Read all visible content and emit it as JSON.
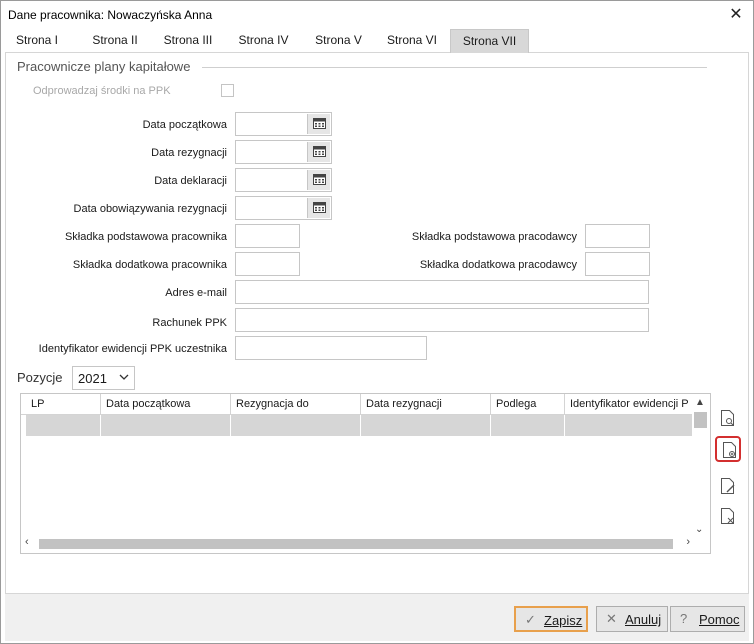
{
  "window": {
    "title": "Dane pracownika: Nowaczyńska Anna",
    "close_glyph": "✕"
  },
  "tabs": [
    {
      "label": "Strona I",
      "active": false
    },
    {
      "label": "Strona II",
      "active": false
    },
    {
      "label": "Strona III",
      "active": false
    },
    {
      "label": "Strona IV",
      "active": false
    },
    {
      "label": "Strona V",
      "active": false
    },
    {
      "label": "Strona VI",
      "active": false
    },
    {
      "label": "Strona VII",
      "active": true
    }
  ],
  "ppk": {
    "section_title": "Pracownicze plany kapitałowe",
    "send_funds_label": "Odprowadzaj środki na PPK",
    "send_funds_checked": false,
    "start_date_label": "Data początkowa",
    "resignation_date_label": "Data rezygnacji",
    "declaration_date_label": "Data deklaracji",
    "resignation_valid_label": "Data obowiązywania rezygnacji",
    "employee_basic_label": "Składka podstawowa pracownika",
    "employer_basic_label": "Składka podstawowa pracodawcy",
    "employee_extra_label": "Składka dodatkowa pracownika",
    "employer_extra_label": "Składka dodatkowa pracodawcy",
    "email_label": "Adres e-mail",
    "account_label": "Rachunek PPK",
    "participant_id_label": "Identyfikator ewidencji PPK uczestnika",
    "start_date_value": "",
    "resignation_date_value": "",
    "declaration_date_value": "",
    "resignation_valid_value": "",
    "employee_basic_value": "",
    "employer_basic_value": "",
    "employee_extra_value": "",
    "employer_extra_value": "",
    "email_value": "",
    "account_value": "",
    "participant_id_value": ""
  },
  "positions": {
    "label": "Pozycje",
    "year": "2021",
    "columns": [
      "LP",
      "Data początkowa",
      "Rezygnacja do",
      "Data rezygnacji",
      "Podlega",
      "Identyfikator ewidencji P"
    ]
  },
  "side_toolbar": [
    {
      "icon": "view-document-icon"
    },
    {
      "icon": "add-document-icon",
      "highlighted": true
    },
    {
      "icon": "edit-document-icon"
    },
    {
      "icon": "delete-document-icon"
    }
  ],
  "footer": {
    "save_label": "Zapisz",
    "cancel_label": "Anuluj",
    "help_label": "Pomoc",
    "save_glyph": "✓",
    "cancel_glyph": "✕",
    "help_glyph": "?"
  },
  "colors": {
    "highlight": "#d32f2f",
    "primary_border": "#e8a04c",
    "active_tab": "#d8d8d8"
  }
}
